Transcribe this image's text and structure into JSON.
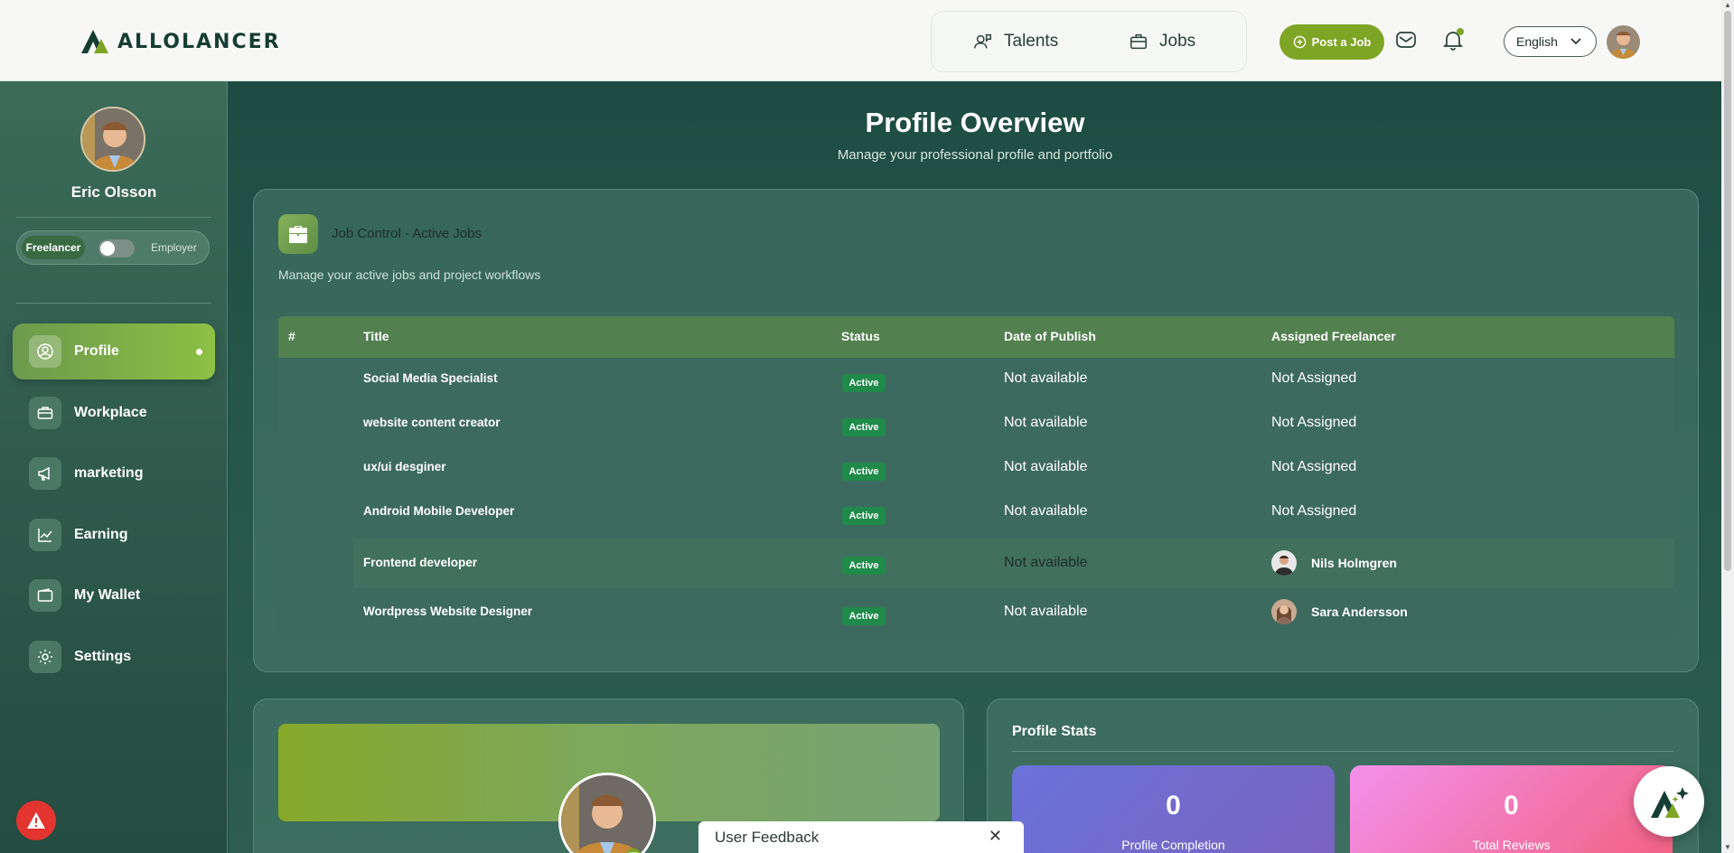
{
  "header": {
    "logo_text": "ALLOLANCER",
    "nav": [
      {
        "label": "Talents"
      },
      {
        "label": "Jobs"
      }
    ],
    "post_job_label": "Post a Job",
    "language": "English"
  },
  "sidebar": {
    "user_name": "Eric Olsson",
    "role_active": "Freelancer",
    "role_other": "Employer",
    "items": [
      {
        "label": "Profile",
        "icon": "user-icon",
        "active": true
      },
      {
        "label": "Workplace",
        "icon": "briefcase-icon"
      },
      {
        "label": "marketing",
        "icon": "megaphone-icon"
      },
      {
        "label": "Earning",
        "icon": "chart-icon"
      },
      {
        "label": "My Wallet",
        "icon": "wallet-icon"
      },
      {
        "label": "Settings",
        "icon": "gear-icon"
      }
    ]
  },
  "main": {
    "title": "Profile Overview",
    "subtitle": "Manage your professional profile and portfolio",
    "jobs_card": {
      "title": "Job Control - Active Jobs",
      "description": "Manage your active jobs and project workflows",
      "columns": [
        "#",
        "Title",
        "Status",
        "Date of Publish",
        "Assigned Freelancer"
      ],
      "rows": [
        {
          "title": "Social Media Specialist",
          "status": "Active",
          "date": "Not available",
          "freelancer": "Not Assigned"
        },
        {
          "title": "website content creator",
          "status": "Active",
          "date": "Not available",
          "freelancer": "Not Assigned"
        },
        {
          "title": "ux/ui desginer",
          "status": "Active",
          "date": "Not available",
          "freelancer": "Not Assigned"
        },
        {
          "title": "Android Mobile Developer",
          "status": "Active",
          "date": "Not available",
          "freelancer": "Not Assigned"
        },
        {
          "title": "Frontend developer",
          "status": "Active",
          "date": "Not available",
          "freelancer": "Nils Holmgren"
        },
        {
          "title": "Wordpress Website Designer",
          "status": "Active",
          "date": "Not available",
          "freelancer": "Sara Andersson"
        }
      ]
    },
    "stats": {
      "title": "Profile Stats",
      "items": [
        {
          "value": "0",
          "label": "Profile Completion"
        },
        {
          "value": "0",
          "label": "Total Reviews"
        }
      ]
    }
  },
  "feedback": {
    "label": "User Feedback",
    "close": "✕"
  },
  "colors": {
    "brand": "#7ea525",
    "sidebar_active": "#8dc043",
    "badge": "#1f8a4a",
    "alert": "#e3342f"
  }
}
